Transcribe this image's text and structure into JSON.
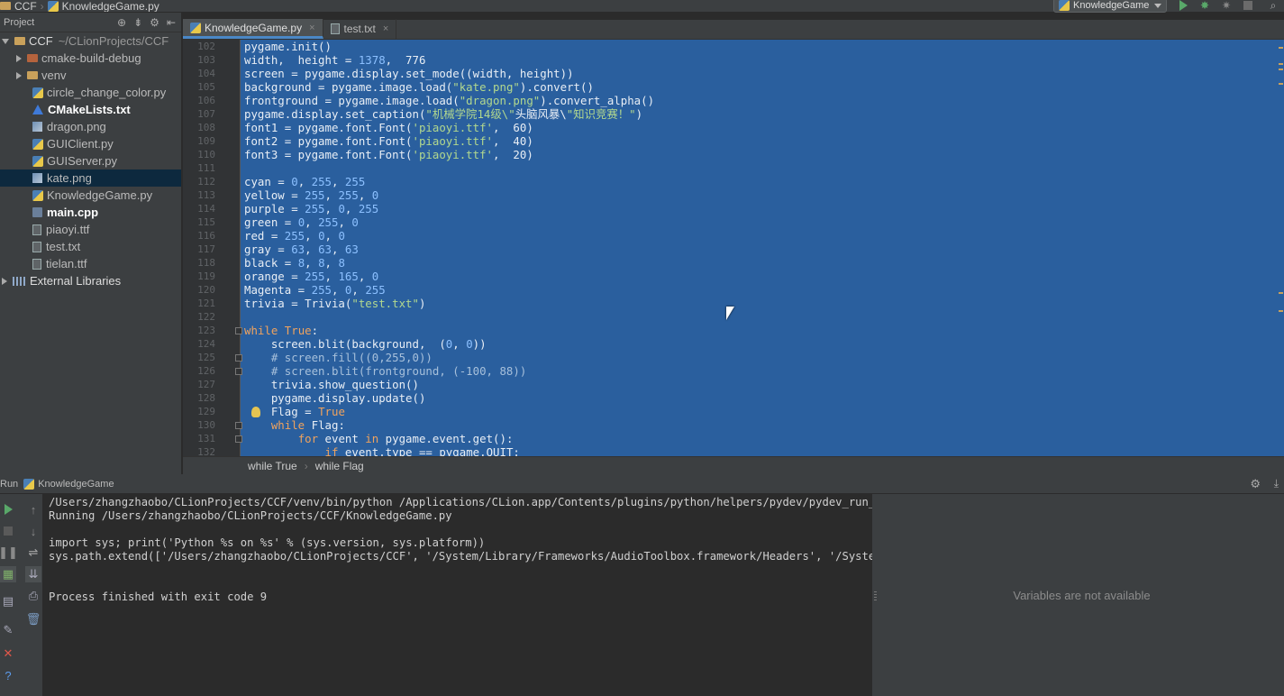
{
  "topbar": {
    "project": "CCF",
    "file": "KnowledgeGame.py",
    "run_config": "KnowledgeGame"
  },
  "project_panel": {
    "title": "Project",
    "root_name": "CCF",
    "root_path": "~/CLionProjects/CCF",
    "items": [
      {
        "label": "cmake-build-debug",
        "kind": "folder"
      },
      {
        "label": "venv",
        "kind": "folder"
      },
      {
        "label": "circle_change_color.py",
        "kind": "py"
      },
      {
        "label": "CMakeLists.txt",
        "kind": "cmake"
      },
      {
        "label": "dragon.png",
        "kind": "png"
      },
      {
        "label": "GUIClient.py",
        "kind": "py"
      },
      {
        "label": "GUIServer.py",
        "kind": "py"
      },
      {
        "label": "kate.png",
        "kind": "png"
      },
      {
        "label": "KnowledgeGame.py",
        "kind": "py"
      },
      {
        "label": "main.cpp",
        "kind": "cpp"
      },
      {
        "label": "piaoyi.ttf",
        "kind": "txt"
      },
      {
        "label": "test.txt",
        "kind": "txt"
      },
      {
        "label": "tielan.ttf",
        "kind": "txt"
      }
    ],
    "external": "External Libraries"
  },
  "tabs": [
    {
      "label": "KnowledgeGame.py",
      "close": "×"
    },
    {
      "label": "test.txt",
      "close": "×"
    }
  ],
  "editor": {
    "line_numbers": [
      "102",
      "103",
      "104",
      "105",
      "106",
      "107",
      "108",
      "109",
      "110",
      "111",
      "112",
      "113",
      "114",
      "115",
      "116",
      "117",
      "118",
      "119",
      "120",
      "121",
      "122",
      "123",
      "124",
      "125",
      "126",
      "127",
      "128",
      "129",
      "130",
      "131",
      "132"
    ],
    "lines": [
      "pygame.init()",
      "width,  height = 1378,  776",
      "screen = pygame.display.set_mode((width, height))",
      "background = pygame.image.load(\"kate.png\").convert()",
      "frontground = pygame.image.load(\"dragon.png\").convert_alpha()",
      "pygame.display.set_caption(\"机械学院14级\\\"头脑风暴\\\"知识竞赛！\")",
      "font1 = pygame.font.Font('piaoyi.ttf',  60)",
      "font2 = pygame.font.Font('piaoyi.ttf',  40)",
      "font3 = pygame.font.Font('piaoyi.ttf',  20)",
      "",
      "cyan = 0, 255, 255",
      "yellow = 255, 255, 0",
      "purple = 255, 0, 255",
      "green = 0, 255, 0",
      "red = 255, 0, 0",
      "gray = 63, 63, 63",
      "black = 8, 8, 8",
      "orange = 255, 165, 0",
      "Magenta = 255, 0, 255",
      "trivia = Trivia(\"test.txt\")",
      "",
      "while True:",
      "    screen.blit(background,  (0, 0))",
      "    # screen.fill((0,255,0))",
      "    # screen.blit(frontground, (-100, 88))",
      "    trivia.show_question()",
      "    pygame.display.update()",
      "    Flag = True",
      "    while Flag:",
      "        for event in pygame.event.get():",
      "            if event.type == pygame.QUIT:"
    ]
  },
  "breadcrumb": [
    "while True",
    "while Flag"
  ],
  "run": {
    "label": "Run",
    "config": "KnowledgeGame",
    "console": [
      "/Users/zhangzhaobo/CLionProjects/CCF/venv/bin/python /Applications/CLion.app/Contents/plugins/python/helpers/pydev/pydev_run_in_cor",
      "Running /Users/zhangzhaobo/CLionProjects/CCF/KnowledgeGame.py",
      "",
      "import sys; print('Python %s on %s' % (sys.version, sys.platform))",
      "sys.path.extend(['/Users/zhangzhaobo/CLionProjects/CCF', '/System/Library/Frameworks/AudioToolbox.framework/Headers', '/System/Libr",
      "",
      "",
      "Process finished with exit code 9"
    ],
    "variables_placeholder": "Variables are not available"
  },
  "colors": {
    "selection": "#2a5f9e",
    "panel": "#3c3f41",
    "background": "#2b2b2b",
    "accent": "#4a88c7"
  }
}
